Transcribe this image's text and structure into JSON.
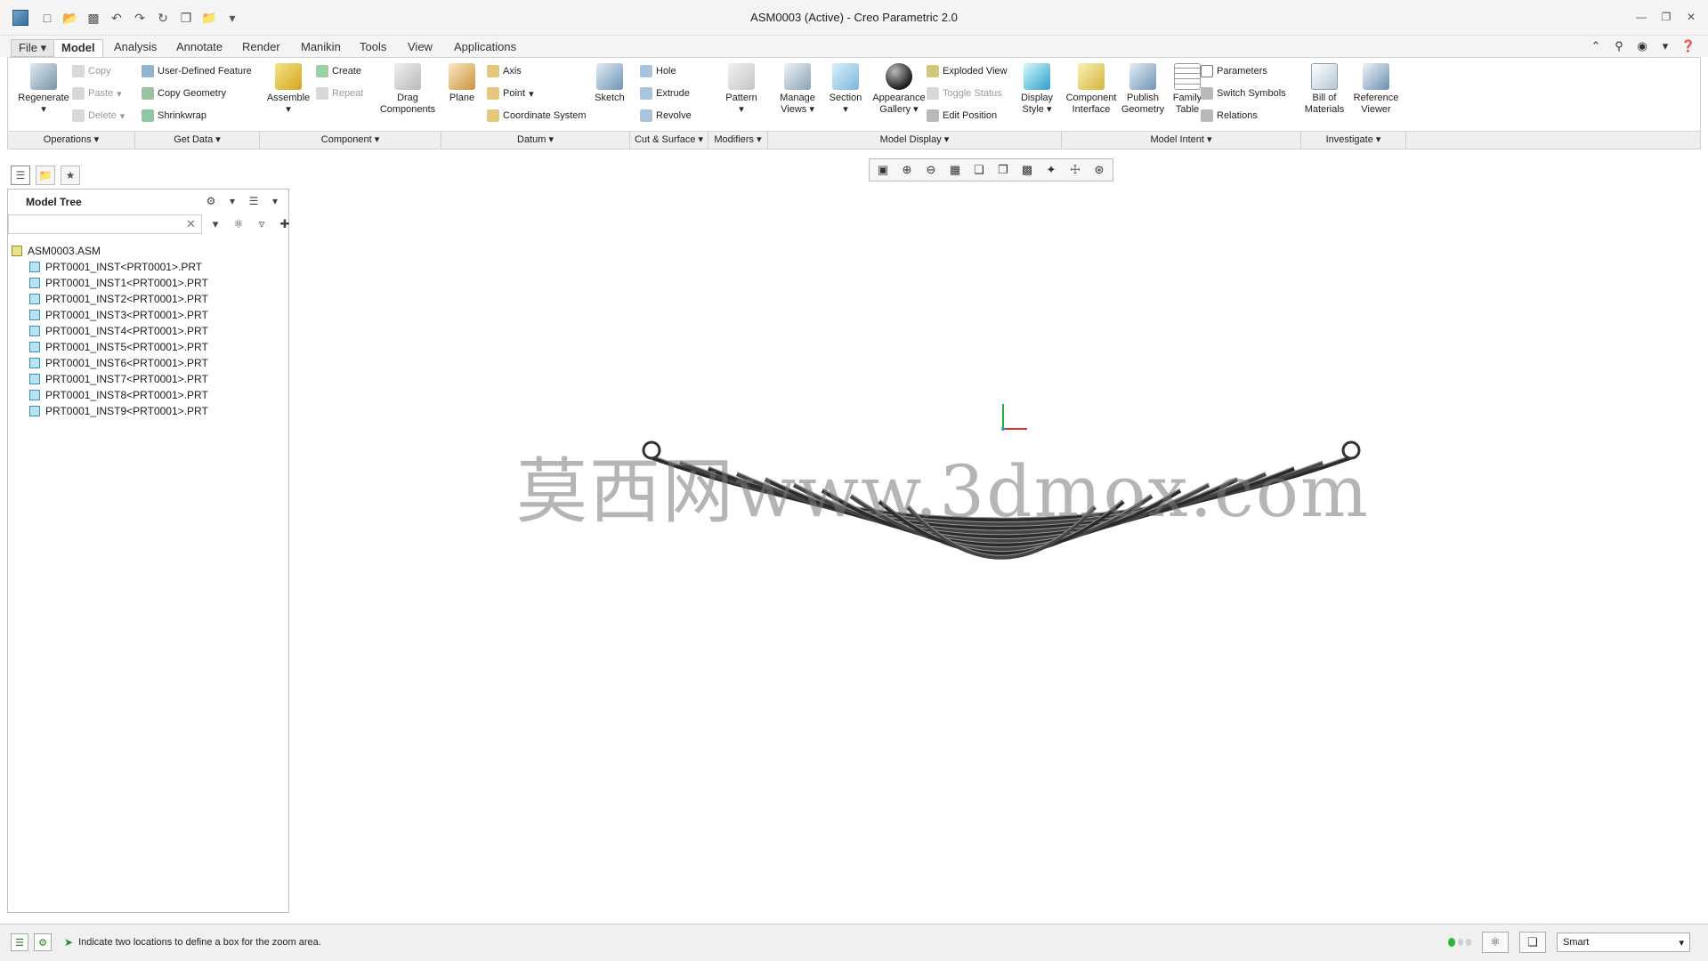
{
  "window": {
    "title": "ASM0003 (Active) - Creo Parametric 2.0",
    "quick_access_icons": [
      "new-icon",
      "open-icon",
      "save-icon",
      "undo-icon",
      "redo-icon",
      "regenerate-icon",
      "windows-icon",
      "close-window-icon",
      "customize-icon"
    ]
  },
  "menu_tabs": [
    {
      "label": "File"
    },
    {
      "label": "Model"
    },
    {
      "label": "Analysis"
    },
    {
      "label": "Annotate"
    },
    {
      "label": "Render"
    },
    {
      "label": "Manikin"
    },
    {
      "label": "Tools"
    },
    {
      "label": "View"
    },
    {
      "label": "Applications"
    }
  ],
  "ribbon": {
    "regenerate": "Regenerate",
    "copy": "Copy",
    "paste": "Paste",
    "delete": "Delete",
    "user_defined_feature": "User-Defined Feature",
    "copy_geometry": "Copy Geometry",
    "shrinkwrap": "Shrinkwrap",
    "assemble": "Assemble",
    "create": "Create",
    "repeat": "Repeat",
    "drag_components": "Drag Components",
    "plane": "Plane",
    "axis": "Axis",
    "point": "Point",
    "coordinate_system": "Coordinate System",
    "sketch": "Sketch",
    "hole": "Hole",
    "extrude": "Extrude",
    "revolve": "Revolve",
    "pattern": "Pattern",
    "manage_views": "Manage Views",
    "section": "Section",
    "appearance_gallery": "Appearance Gallery",
    "exploded_view": "Exploded View",
    "toggle_status": "Toggle Status",
    "edit_position": "Edit Position",
    "display_style": "Display Style",
    "component_interface": "Component Interface",
    "publish_geometry": "Publish Geometry",
    "family_table": "Family Table",
    "parameters": "Parameters",
    "switch_symbols": "Switch Symbols",
    "relations": "Relations",
    "bill_of_materials": "Bill of Materials",
    "reference_viewer": "Reference Viewer"
  },
  "ribbon_groups": [
    {
      "label": "Operations"
    },
    {
      "label": "Get Data"
    },
    {
      "label": "Component"
    },
    {
      "label": "Datum"
    },
    {
      "label": "Cut & Surface"
    },
    {
      "label": "Modifiers"
    },
    {
      "label": "Model Display"
    },
    {
      "label": "Model Intent"
    },
    {
      "label": "Investigate"
    }
  ],
  "model_tree": {
    "header": "Model Tree",
    "search_value": "",
    "root": "ASM0003.ASM",
    "children": [
      "PRT0001_INST<PRT0001>.PRT",
      "PRT0001_INST1<PRT0001>.PRT",
      "PRT0001_INST2<PRT0001>.PRT",
      "PRT0001_INST3<PRT0001>.PRT",
      "PRT0001_INST4<PRT0001>.PRT",
      "PRT0001_INST5<PRT0001>.PRT",
      "PRT0001_INST6<PRT0001>.PRT",
      "PRT0001_INST7<PRT0001>.PRT",
      "PRT0001_INST8<PRT0001>.PRT",
      "PRT0001_INST9<PRT0001>.PRT"
    ]
  },
  "graphics": {
    "watermark": "莫西网www.3dmox.com",
    "model": "leaf-spring-assembly",
    "axis_colors": {
      "x": "#e03030",
      "y": "#20b040"
    }
  },
  "status": {
    "message": "Indicate two locations to define a box for the zoom area.",
    "filter": "Smart"
  }
}
